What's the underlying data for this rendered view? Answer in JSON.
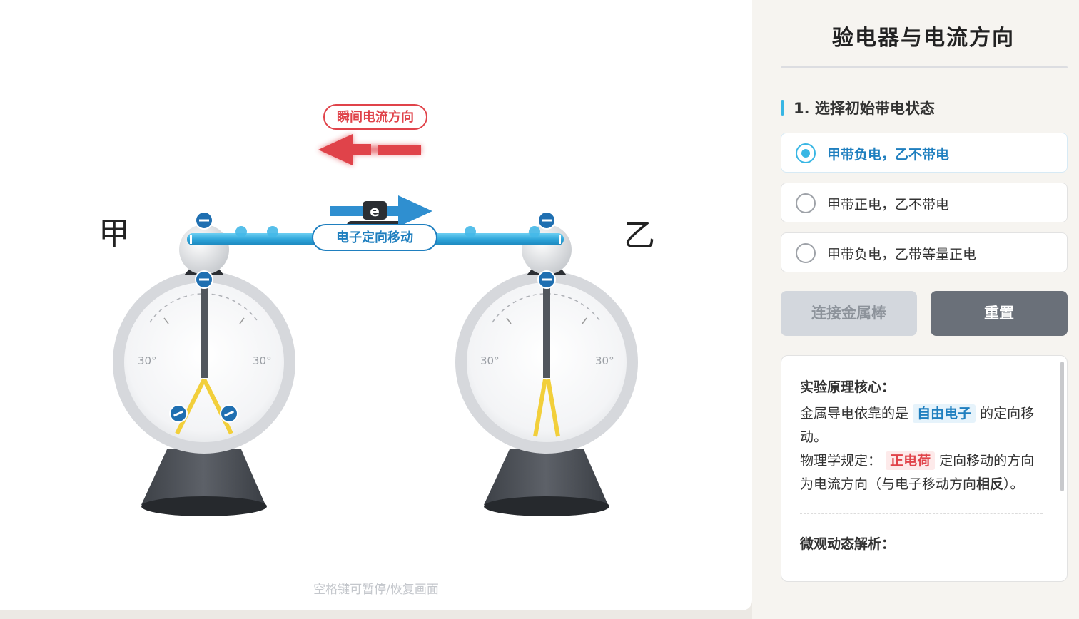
{
  "stage": {
    "current_label": "瞬间电流方向",
    "electron_label": "电子定向移动",
    "electron_symbol": "e",
    "left_name": "甲",
    "right_name": "乙",
    "angle_label": "30°",
    "hint": "空格键可暂停/恢复画面"
  },
  "panel": {
    "title": "验电器与电流方向",
    "section_title": "1. 选择初始带电状态",
    "options": [
      {
        "label": "甲带负电，乙不带电",
        "selected": true
      },
      {
        "label": "甲带正电，乙不带电",
        "selected": false
      },
      {
        "label": "甲带负电，乙带等量正电",
        "selected": false
      }
    ],
    "connect_button": "连接金属棒",
    "reset_button": "重置",
    "info": {
      "head1": "实验原理核心：",
      "p1_a": "金属导电依靠的是",
      "p1_hl": "自由电子",
      "p1_b": "的定向移动。",
      "p2_a": "物理学规定：",
      "p2_hl": "正电荷",
      "p2_b": "定向移动的方向为电流方向（与电子移动方向",
      "p2_strong": "相反",
      "p2_c": "）。",
      "head2": "微观动态解析："
    }
  },
  "colors": {
    "accent": "#38b6e4",
    "current_red": "#e0434a",
    "electron_blue": "#1f7fbf",
    "rod": "#2fa6da"
  }
}
